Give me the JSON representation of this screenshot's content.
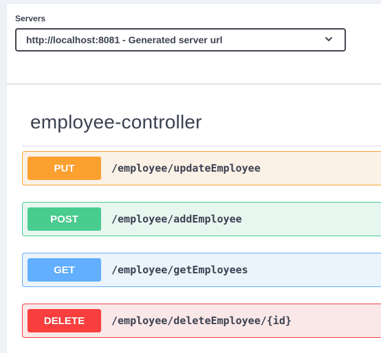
{
  "servers": {
    "label": "Servers",
    "selected": "http://localhost:8081 - Generated server url",
    "icon": "chevron-down-icon"
  },
  "controller": {
    "title": "employee-controller"
  },
  "operations": [
    {
      "method": "PUT",
      "path": "/employee/updateEmployee",
      "color": "#fca130"
    },
    {
      "method": "POST",
      "path": "/employee/addEmployee",
      "color": "#49cc90"
    },
    {
      "method": "GET",
      "path": "/employee/getEmployees",
      "color": "#61affe"
    },
    {
      "method": "DELETE",
      "path": "/employee/deleteEmployee/{id}",
      "color": "#f93e3e"
    }
  ]
}
